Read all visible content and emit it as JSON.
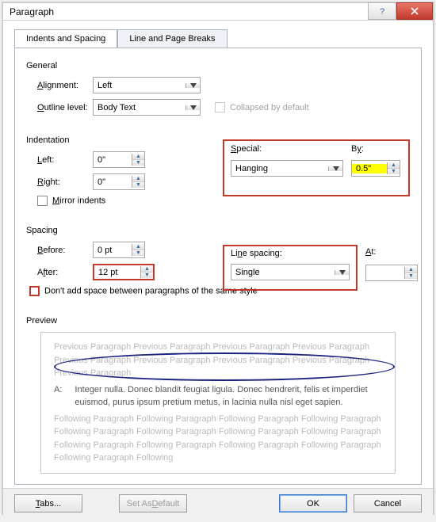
{
  "title": "Paragraph",
  "tabs": {
    "indents": "Indents and Spacing",
    "linebreaks": "Line and Page Breaks"
  },
  "general": {
    "heading": "General",
    "alignment_label": "Alignment:",
    "alignment_value": "Left",
    "outline_label": "Outline level:",
    "outline_value": "Body Text",
    "collapsed_label": "Collapsed by default"
  },
  "indentation": {
    "heading": "Indentation",
    "left_label": "Left:",
    "left_value": "0\"",
    "right_label": "Right:",
    "right_value": "0\"",
    "special_label": "Special:",
    "special_value": "Hanging",
    "by_label": "By:",
    "by_value": "0.5\"",
    "mirror_label": "Mirror indents"
  },
  "spacing": {
    "heading": "Spacing",
    "before_label": "Before:",
    "before_value": "0 pt",
    "after_label": "After:",
    "after_value": "12 pt",
    "line_label": "Line spacing:",
    "line_value": "Single",
    "at_label": "At:",
    "at_value": "",
    "dontadd_label": "Don't add space between paragraphs of the same style"
  },
  "preview": {
    "heading": "Preview",
    "prev": "Previous Paragraph Previous Paragraph Previous Paragraph Previous Paragraph Previous Paragraph Previous Paragraph Previous Paragraph Previous Paragraph Previous Paragraph",
    "mainA": "A:",
    "main": "Integer nulla. Donec blandit feugiat ligula. Donec hendrerit, felis et imperdiet euismod, purus ipsum pretium metus, in lacinia nulla nisl eget sapien.",
    "next": "Following Paragraph Following Paragraph Following Paragraph Following Paragraph Following Paragraph Following Paragraph Following Paragraph Following Paragraph Following Paragraph Following Paragraph Following Paragraph Following Paragraph Following Paragraph Following"
  },
  "buttons": {
    "tabs": "Tabs...",
    "default": "Set As Default",
    "ok": "OK",
    "cancel": "Cancel"
  }
}
